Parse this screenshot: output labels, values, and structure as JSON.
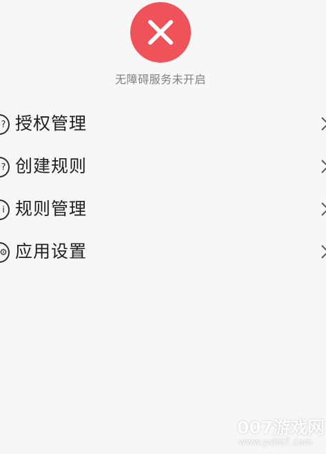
{
  "status": {
    "icon": "close-icon",
    "color": "#f05259",
    "text": "无障碍服务未开启"
  },
  "menu": {
    "items": [
      {
        "label": "授权管理",
        "icon": "circle-icon",
        "icon_glyph": "?"
      },
      {
        "label": "创建规则",
        "icon": "circle-icon",
        "icon_glyph": "?"
      },
      {
        "label": "规则管理",
        "icon": "circle-icon",
        "icon_glyph": "i"
      },
      {
        "label": "应用设置",
        "icon": "circle-icon",
        "icon_glyph": "⚙"
      }
    ],
    "trailing_icon": "chevron-right-icon"
  },
  "watermark": {
    "brand": "007游戏网",
    "url": "www.yx007.com"
  }
}
